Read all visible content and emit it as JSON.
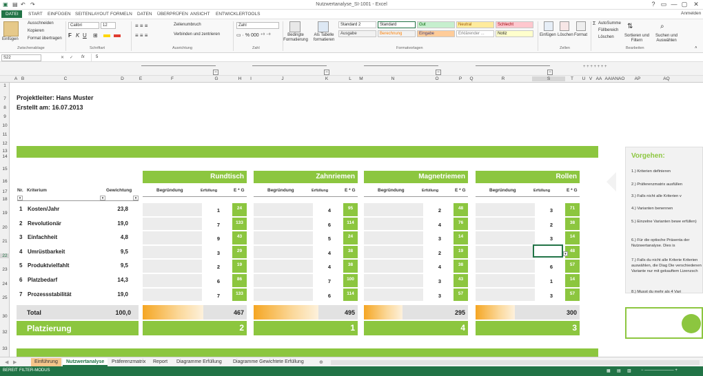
{
  "window": {
    "title": "Nutzwertanalyse_SI-1001 - Excel",
    "user": "Anmelden",
    "controls": [
      "?",
      "▭",
      "—",
      "▢",
      "✕"
    ]
  },
  "ribbon_tabs": [
    "DATEI",
    "START",
    "EINFÜGEN",
    "SEITENLAYOUT",
    "FORMELN",
    "DATEN",
    "ÜBERPRÜFEN",
    "ANSICHT",
    "ENTWICKLERTOOLS"
  ],
  "ribbon": {
    "paste": "Einfügen",
    "cut": "Ausschneiden",
    "copy": "Kopieren",
    "format_painter": "Format übertragen",
    "group_clipboard": "Zwischenablage",
    "font_name": "Calibri",
    "font_size": "12",
    "group_font": "Schriftart",
    "wrap": "Zeilenumbruch",
    "merge": "Verbinden und zentrieren",
    "group_alignment": "Ausrichtung",
    "number_format": "Zahl",
    "group_number": "Zahl",
    "cond_format": "Bedingte Formatierung",
    "as_table": "Als Tabelle formatieren",
    "styles": [
      {
        "label": "Standard 2",
        "bg": "#ffffff",
        "fg": "#222222"
      },
      {
        "label": "Standard",
        "bg": "#ffffff",
        "fg": "#222222"
      },
      {
        "label": "Gut",
        "bg": "#c6efce",
        "fg": "#006100"
      },
      {
        "label": "Neutral",
        "bg": "#ffeb9c",
        "fg": "#9c5700"
      },
      {
        "label": "Schlecht",
        "bg": "#ffc7ce",
        "fg": "#9c0006"
      },
      {
        "label": "Ausgabe",
        "bg": "#f2f2f2",
        "fg": "#3f3f3f"
      },
      {
        "label": "Berechnung",
        "bg": "#f2f2f2",
        "fg": "#fa7d00"
      },
      {
        "label": "Eingabe",
        "bg": "#ffcc99",
        "fg": "#3f3f76"
      },
      {
        "label": "Erklärender ...",
        "bg": "#ffffff",
        "fg": "#7f7f7f"
      },
      {
        "label": "Notiz",
        "bg": "#ffffcc",
        "fg": "#222222"
      }
    ],
    "group_styles": "Formatvorlagen",
    "insert": "Einfügen",
    "delete": "Löschen",
    "format": "Format",
    "group_cells": "Zellen",
    "autosum": "AutoSumme",
    "fill": "Füllbereich",
    "clear": "Löschen",
    "sort": "Sortieren und Filtern",
    "find": "Suchen und Auswählen",
    "group_edit": "Bearbeiten"
  },
  "formula_bar": {
    "namebox": "S22",
    "fx": "fx",
    "value": "5"
  },
  "column_headers": [
    "A",
    "B",
    "C",
    "D",
    "E",
    "F",
    "G",
    "H",
    "I",
    "J",
    "K",
    "L",
    "M",
    "N",
    "O",
    "P",
    "Q",
    "R",
    "S",
    "T",
    "U",
    "V",
    "AA",
    "AAIANAO",
    "AP",
    "AQ"
  ],
  "row_headers": [
    "1",
    "7",
    "8",
    "9",
    "10",
    "11",
    "12",
    "13",
    "14",
    "15",
    "16",
    "17",
    "18",
    "19",
    "20",
    "21",
    "22",
    "23",
    "24",
    "25",
    "30",
    "32",
    "33"
  ],
  "sheet": {
    "projektleiter": "Projektleiter: Hans Muster",
    "erstellt": "Erstellt am: 16.07.2013",
    "col_nr": "Nr.",
    "col_kriterium": "Kriterium",
    "col_gewichtung": "Gewichtung",
    "col_begruendung": "Begründung",
    "col_erfuellung": "Erfüllung",
    "col_eg": "E * G",
    "criteria": [
      {
        "nr": "1",
        "name": "Kosten/Jahr",
        "weight": "23,8"
      },
      {
        "nr": "2",
        "name": "Revolutionär",
        "weight": "19,0"
      },
      {
        "nr": "3",
        "name": "Einfachheit",
        "weight": "4,8"
      },
      {
        "nr": "4",
        "name": "Umrüstbarkeit",
        "weight": "9,5"
      },
      {
        "nr": "5",
        "name": "Produktvielfahlt",
        "weight": "9,5"
      },
      {
        "nr": "6",
        "name": "Platzbedarf",
        "weight": "14,3"
      },
      {
        "nr": "7",
        "name": "Prozessstabilität",
        "weight": "19,0"
      }
    ],
    "total_label": "Total",
    "total_weight": "100,0",
    "placement_label": "Platzierung",
    "variants": [
      {
        "name": "Rundtisch",
        "fulfil": [
          "1",
          "7",
          "9",
          "3",
          "2",
          "6",
          "7"
        ],
        "eg": [
          "24",
          "133",
          "43",
          "29",
          "19",
          "86",
          "133"
        ],
        "total": "467",
        "total_fraction": 0.94,
        "rank": "2"
      },
      {
        "name": "Zahnriemen",
        "fulfil": [
          "4",
          "6",
          "5",
          "4",
          "4",
          "7",
          "6"
        ],
        "eg": [
          "95",
          "114",
          "24",
          "38",
          "38",
          "100",
          "114"
        ],
        "total": "495",
        "total_fraction": 1.0,
        "rank": "1"
      },
      {
        "name": "Magnetriemen",
        "fulfil": [
          "2",
          "4",
          "3",
          "2",
          "4",
          "3",
          "3"
        ],
        "eg": [
          "48",
          "76",
          "14",
          "19",
          "38",
          "43",
          "57"
        ],
        "total": "295",
        "total_fraction": 0.6,
        "rank": "4"
      },
      {
        "name": "Rollen",
        "fulfil": [
          "3",
          "2",
          "3",
          "5",
          "6",
          "1",
          "3"
        ],
        "eg": [
          "71",
          "38",
          "14",
          "48",
          "57",
          "14",
          "57"
        ],
        "total": "300",
        "total_fraction": 0.61,
        "rank": "3"
      }
    ]
  },
  "panel": {
    "heading": "Vorgehen:",
    "steps": [
      "1.) Kriterien definieren",
      "2.) Präferenzmatrix ausfüllen",
      "3.) Falls nicht alle Kriterien v",
      "4.) Varianten benennen",
      "5.) Einzelne Varianten bewe erfüllen)",
      "6.) Für die optische Präsenta der Nutzwertanalyse. Dies is",
      "7.) Falls du nicht alle Kriterie Kriterien auswählen, die Diag Die verschiedenen Variante nur mit gekauftem Lizenzsch",
      "8.) Musst du mehr als 4 Vari"
    ]
  },
  "sheet_tabs": [
    "Einführung",
    "Nutzwertanalyse",
    "Präferenzmatrix",
    "Report",
    "Diagramme Erfüllung",
    "Diagramme Gewichtete Erfüllung"
  ],
  "status": {
    "left": "BEREIT",
    "mode": "FILTER-MODUS"
  },
  "colors": {
    "accent": "#8cc63f",
    "excel_green": "#217346",
    "orange": "#f5a623"
  }
}
